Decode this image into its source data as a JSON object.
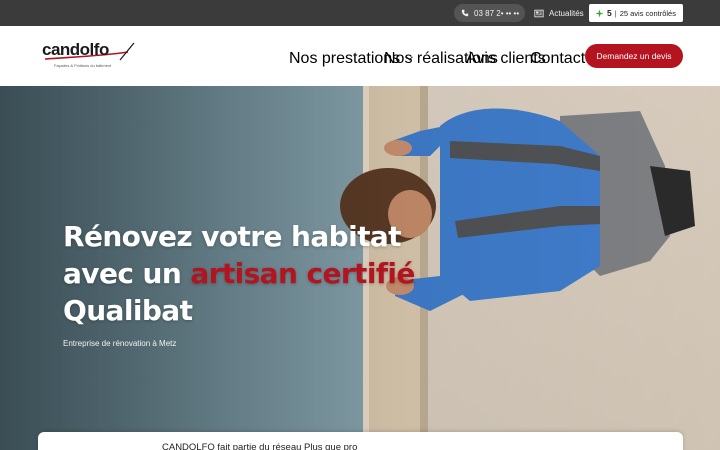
{
  "topbar": {
    "phone": "03 87 2• •• ••",
    "news_label": "Actualités",
    "reviews_score": "5",
    "reviews_label": "25 avis contrôlés"
  },
  "header": {
    "logo_text": "candolfo",
    "logo_tagline": "Façades & Finitions du bâtiment",
    "nav": {
      "services": "Nos prestations",
      "projects": "Nos réalisations",
      "reviews": "Avis clients",
      "contact": "Contact"
    },
    "cta_label": "Demandez un devis"
  },
  "hero": {
    "title_line1": "Rénovez votre habitat",
    "title_line2_prefix": "avec un ",
    "title_line2_accent": "artisan certifié",
    "title_line3": "Qualibat",
    "subtitle": "Entreprise de rénovation à Metz"
  },
  "card": {
    "text": "CANDOLFO fait partie du réseau Plus que pro"
  },
  "colors": {
    "brand_red": "#b3141f",
    "topbar_bg": "#3c3b3b",
    "reviews_green": "#3aa935"
  }
}
